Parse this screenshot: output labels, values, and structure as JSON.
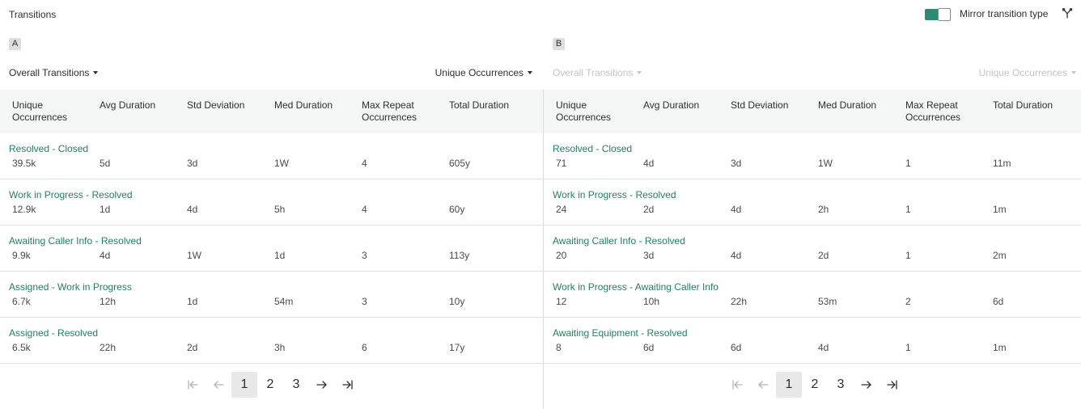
{
  "header": {
    "title": "Transitions",
    "mirror_label": "Mirror transition type",
    "mirror_on": true,
    "accent": "#2d8a73"
  },
  "panels": [
    {
      "badge": "A",
      "left_dropdown": "Overall Transitions",
      "right_dropdown": "Unique Occurrences",
      "disabled": false,
      "columns": [
        "Unique Occurrences",
        "Avg Duration",
        "Std Deviation",
        "Med Duration",
        "Max Repeat Occurrences",
        "Total Duration"
      ],
      "rows": [
        {
          "name": "Resolved - Closed",
          "values": [
            "39.5k",
            "5d",
            "3d",
            "1W",
            "4",
            "605y"
          ]
        },
        {
          "name": "Work in Progress - Resolved",
          "values": [
            "12.9k",
            "1d",
            "4d",
            "5h",
            "4",
            "60y"
          ]
        },
        {
          "name": "Awaiting Caller Info - Resolved",
          "values": [
            "9.9k",
            "4d",
            "1W",
            "1d",
            "3",
            "113y"
          ]
        },
        {
          "name": "Assigned - Work in Progress",
          "values": [
            "6.7k",
            "12h",
            "1d",
            "54m",
            "3",
            "10y"
          ]
        },
        {
          "name": "Assigned - Resolved",
          "values": [
            "6.5k",
            "22h",
            "2d",
            "3h",
            "6",
            "17y"
          ]
        }
      ],
      "pages": [
        "1",
        "2",
        "3"
      ],
      "current_page": "1"
    },
    {
      "badge": "B",
      "left_dropdown": "Overall Transitions",
      "right_dropdown": "Unique Occurrences",
      "disabled": true,
      "columns": [
        "Unique Occurrences",
        "Avg Duration",
        "Std Deviation",
        "Med Duration",
        "Max Repeat Occurrences",
        "Total Duration"
      ],
      "rows": [
        {
          "name": "Resolved - Closed",
          "values": [
            "71",
            "4d",
            "3d",
            "1W",
            "1",
            "11m"
          ]
        },
        {
          "name": "Work in Progress - Resolved",
          "values": [
            "24",
            "2d",
            "4d",
            "2h",
            "1",
            "1m"
          ]
        },
        {
          "name": "Awaiting Caller Info - Resolved",
          "values": [
            "20",
            "3d",
            "4d",
            "2d",
            "1",
            "2m"
          ]
        },
        {
          "name": "Work in Progress - Awaiting Caller Info",
          "values": [
            "12",
            "10h",
            "22h",
            "53m",
            "2",
            "6d"
          ]
        },
        {
          "name": "Awaiting Equipment - Resolved",
          "values": [
            "8",
            "6d",
            "6d",
            "4d",
            "1",
            "1m"
          ]
        }
      ],
      "pages": [
        "1",
        "2",
        "3"
      ],
      "current_page": "1"
    }
  ],
  "icons": {
    "mirror_toggle": "toggle-switch-icon",
    "branch": "branch-icon",
    "first": "first-page-icon",
    "prev": "previous-page-icon",
    "next": "next-page-icon",
    "last": "last-page-icon"
  }
}
